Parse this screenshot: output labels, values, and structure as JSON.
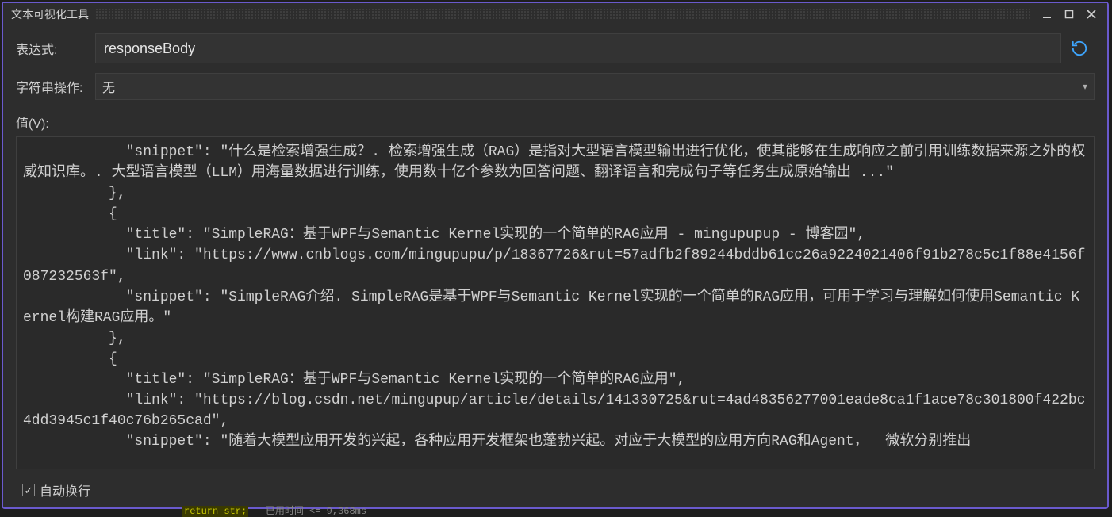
{
  "titlebar": {
    "title": "文本可视化工具"
  },
  "form": {
    "expression_label": "表达式:",
    "expression_value": "responseBody",
    "string_ops_label": "字符串操作:",
    "string_ops_value": "无",
    "value_label": "值(V):"
  },
  "value_text": "            \"snippet\": \"什么是检索增强生成？. 检索增强生成（RAG）是指对大型语言模型输出进行优化，使其能够在生成响应之前引用训练数据来源之外的权威知识库。. 大型语言模型（LLM）用海量数据进行训练，使用数十亿个参数为回答问题、翻译语言和完成句子等任务生成原始输出 ...\"\n          },\n          {\n            \"title\": \"SimpleRAG：基于WPF与Semantic Kernel实现的一个简单的RAG应用 - mingupupup - 博客园\",\n            \"link\": \"https://www.cnblogs.com/mingupupu/p/18367726&rut=57adfb2f89244bddb61cc26a9224021406f91b278c5c1f88e4156f087232563f\",\n            \"snippet\": \"SimpleRAG介绍. SimpleRAG是基于WPF与Semantic Kernel实现的一个简单的RAG应用，可用于学习与理解如何使用Semantic Kernel构建RAG应用。\"\n          },\n          {\n            \"title\": \"SimpleRAG：基于WPF与Semantic Kernel实现的一个简单的RAG应用\",\n            \"link\": \"https://blog.csdn.net/mingupup/article/details/141330725&rut=4ad48356277001eade8ca1f1ace78c301800f422bc4dd3945c1f40c76b265cad\",\n            \"snippet\": \"随着大模型应用开发的兴起，各种应用开发框架也蓬勃兴起。对应于大模型的应用方向RAG和Agent，  微软分别推出",
  "footer": {
    "wrap_label": "自动换行",
    "wrap_checked": true
  },
  "bg_strip": {
    "left": "return str;",
    "right": "已用时间 <= 9,368ms"
  },
  "icons": {
    "minimize": "minimize-icon",
    "maximize": "maximize-icon",
    "close": "close-icon",
    "refresh": "refresh-icon",
    "chevron_down": "chevron-down-icon"
  }
}
